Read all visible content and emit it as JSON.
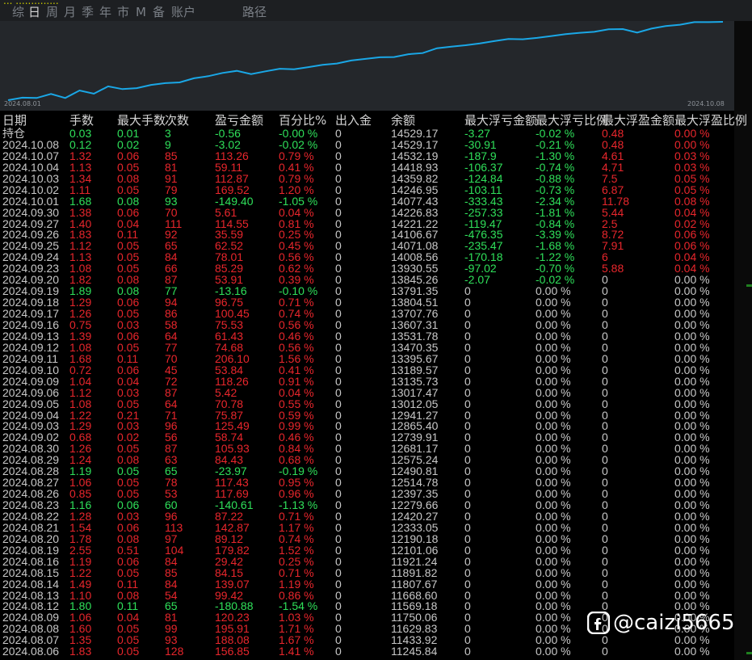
{
  "header": {
    "title_fragment": "... ..............",
    "tabs": [
      {
        "label": "综",
        "active": false
      },
      {
        "label": "日",
        "active": true
      },
      {
        "label": "周",
        "active": false
      },
      {
        "label": "月",
        "active": false
      },
      {
        "label": "季",
        "active": false
      },
      {
        "label": "年",
        "active": false
      },
      {
        "label": "市",
        "active": false
      },
      {
        "label": "M",
        "active": false
      },
      {
        "label": "备",
        "active": false
      },
      {
        "label": "账户",
        "active": false
      },
      {
        "label": "路径",
        "active": false
      }
    ]
  },
  "chart": {
    "start_label": "2024.08.01",
    "end_label": "2024.10.08",
    "line_color": "#1aa7e6",
    "equity_curve": [
      11150,
      11260,
      11245,
      11420,
      11245,
      11570,
      11430,
      11750,
      11630,
      11670,
      11810,
      11890,
      11920,
      12100,
      12190,
      12330,
      12420,
      12280,
      12400,
      12510,
      12490,
      12580,
      12680,
      12740,
      12870,
      12940,
      13010,
      13020,
      13140,
      13190,
      13400,
      13470,
      13530,
      13610,
      13710,
      13800,
      13790,
      13850,
      13930,
      14010,
      14070,
      14110,
      14220,
      14230,
      14080,
      14250,
      14360,
      14420,
      14530,
      14530,
      14545
    ]
  },
  "table": {
    "headers": [
      "日期",
      "手数",
      "最大手数",
      "次数",
      "盈亏金额",
      "百分比%",
      "出入金",
      "余额",
      "最大浮亏金额",
      "最大浮亏比例",
      "最大浮盈金额",
      "最大浮盈比例"
    ],
    "colors": {
      "red": "#e8262c",
      "green": "#2fe05a",
      "neutral": "#c8c8c8"
    },
    "rows": [
      {
        "date": "持仓",
        "lots": "0.03",
        "maxlots": "0.01",
        "count": "3",
        "pnl": "-0.56",
        "pct": "-0.00 %",
        "io": "0",
        "bal": "14529.17",
        "mfl": "-3.27",
        "mflp": "-0.02 %",
        "mfp": "0.48",
        "mfpp": "0.00 %",
        "tone": "green"
      },
      {
        "date": "2024.10.08",
        "lots": "0.12",
        "maxlots": "0.02",
        "count": "9",
        "pnl": "-3.02",
        "pct": "-0.02 %",
        "io": "0",
        "bal": "14529.17",
        "mfl": "-30.91",
        "mflp": "-0.21 %",
        "mfp": "0.48",
        "mfpp": "0.00 %",
        "tone": "green"
      },
      {
        "date": "2024.10.07",
        "lots": "1.32",
        "maxlots": "0.06",
        "count": "85",
        "pnl": "113.26",
        "pct": "0.79 %",
        "io": "0",
        "bal": "14532.19",
        "mfl": "-187.9",
        "mflp": "-1.30 %",
        "mfp": "4.61",
        "mfpp": "0.03 %",
        "tone": "red"
      },
      {
        "date": "2024.10.04",
        "lots": "1.13",
        "maxlots": "0.05",
        "count": "81",
        "pnl": "59.11",
        "pct": "0.41 %",
        "io": "0",
        "bal": "14418.93",
        "mfl": "-106.37",
        "mflp": "-0.74 %",
        "mfp": "4.71",
        "mfpp": "0.03 %",
        "tone": "red"
      },
      {
        "date": "2024.10.03",
        "lots": "1.34",
        "maxlots": "0.08",
        "count": "91",
        "pnl": "112.87",
        "pct": "0.79 %",
        "io": "0",
        "bal": "14359.82",
        "mfl": "-124.84",
        "mflp": "-0.88 %",
        "mfp": "7.5",
        "mfpp": "0.05 %",
        "tone": "red"
      },
      {
        "date": "2024.10.02",
        "lots": "1.11",
        "maxlots": "0.05",
        "count": "79",
        "pnl": "169.52",
        "pct": "1.20 %",
        "io": "0",
        "bal": "14246.95",
        "mfl": "-103.11",
        "mflp": "-0.73 %",
        "mfp": "6.87",
        "mfpp": "0.05 %",
        "tone": "red"
      },
      {
        "date": "2024.10.01",
        "lots": "1.68",
        "maxlots": "0.08",
        "count": "93",
        "pnl": "-149.40",
        "pct": "-1.05 %",
        "io": "0",
        "bal": "14077.43",
        "mfl": "-333.43",
        "mflp": "-2.34 %",
        "mfp": "11.78",
        "mfpp": "0.08 %",
        "tone": "green"
      },
      {
        "date": "2024.09.30",
        "lots": "1.38",
        "maxlots": "0.06",
        "count": "70",
        "pnl": "5.61",
        "pct": "0.04 %",
        "io": "0",
        "bal": "14226.83",
        "mfl": "-257.33",
        "mflp": "-1.81 %",
        "mfp": "5.44",
        "mfpp": "0.04 %",
        "tone": "red"
      },
      {
        "date": "2024.09.27",
        "lots": "1.40",
        "maxlots": "0.04",
        "count": "111",
        "pnl": "114.55",
        "pct": "0.81 %",
        "io": "0",
        "bal": "14221.22",
        "mfl": "-119.47",
        "mflp": "-0.84 %",
        "mfp": "2.5",
        "mfpp": "0.02 %",
        "tone": "red"
      },
      {
        "date": "2024.09.26",
        "lots": "1.83",
        "maxlots": "0.11",
        "count": "92",
        "pnl": "35.59",
        "pct": "0.25 %",
        "io": "0",
        "bal": "14106.67",
        "mfl": "-476.35",
        "mflp": "-3.39 %",
        "mfp": "8.72",
        "mfpp": "0.06 %",
        "tone": "red"
      },
      {
        "date": "2024.09.25",
        "lots": "1.12",
        "maxlots": "0.05",
        "count": "65",
        "pnl": "62.52",
        "pct": "0.45 %",
        "io": "0",
        "bal": "14071.08",
        "mfl": "-235.47",
        "mflp": "-1.68 %",
        "mfp": "7.91",
        "mfpp": "0.06 %",
        "tone": "red"
      },
      {
        "date": "2024.09.24",
        "lots": "1.13",
        "maxlots": "0.05",
        "count": "84",
        "pnl": "78.01",
        "pct": "0.56 %",
        "io": "0",
        "bal": "14008.56",
        "mfl": "-170.18",
        "mflp": "-1.22 %",
        "mfp": "6",
        "mfpp": "0.04 %",
        "tone": "red"
      },
      {
        "date": "2024.09.23",
        "lots": "1.08",
        "maxlots": "0.05",
        "count": "66",
        "pnl": "85.29",
        "pct": "0.62 %",
        "io": "0",
        "bal": "13930.55",
        "mfl": "-97.02",
        "mflp": "-0.70 %",
        "mfp": "5.88",
        "mfpp": "0.04 %",
        "tone": "red"
      },
      {
        "date": "2024.09.20",
        "lots": "1.82",
        "maxlots": "0.08",
        "count": "87",
        "pnl": "53.91",
        "pct": "0.39 %",
        "io": "0",
        "bal": "13845.26",
        "mfl": "-2.07",
        "mflp": "-0.02 %",
        "mfp": "0",
        "mfpp": "0.00 %",
        "tone": "red"
      },
      {
        "date": "2024.09.19",
        "lots": "1.89",
        "maxlots": "0.08",
        "count": "77",
        "pnl": "-13.16",
        "pct": "-0.10 %",
        "io": "0",
        "bal": "13791.35",
        "mfl": "0",
        "mflp": "0.00 %",
        "mfp": "0",
        "mfpp": "0.00 %",
        "tone": "green"
      },
      {
        "date": "2024.09.18",
        "lots": "1.29",
        "maxlots": "0.06",
        "count": "94",
        "pnl": "96.75",
        "pct": "0.71 %",
        "io": "0",
        "bal": "13804.51",
        "mfl": "0",
        "mflp": "0.00 %",
        "mfp": "0",
        "mfpp": "0.00 %",
        "tone": "red"
      },
      {
        "date": "2024.09.17",
        "lots": "1.26",
        "maxlots": "0.05",
        "count": "86",
        "pnl": "100.45",
        "pct": "0.74 %",
        "io": "0",
        "bal": "13707.76",
        "mfl": "0",
        "mflp": "0.00 %",
        "mfp": "0",
        "mfpp": "0.00 %",
        "tone": "red"
      },
      {
        "date": "2024.09.16",
        "lots": "0.75",
        "maxlots": "0.03",
        "count": "58",
        "pnl": "75.53",
        "pct": "0.56 %",
        "io": "0",
        "bal": "13607.31",
        "mfl": "0",
        "mflp": "0.00 %",
        "mfp": "0",
        "mfpp": "0.00 %",
        "tone": "red"
      },
      {
        "date": "2024.09.13",
        "lots": "1.39",
        "maxlots": "0.06",
        "count": "64",
        "pnl": "61.43",
        "pct": "0.46 %",
        "io": "0",
        "bal": "13531.78",
        "mfl": "0",
        "mflp": "0.00 %",
        "mfp": "0",
        "mfpp": "0.00 %",
        "tone": "red"
      },
      {
        "date": "2024.09.12",
        "lots": "1.08",
        "maxlots": "0.05",
        "count": "77",
        "pnl": "74.68",
        "pct": "0.56 %",
        "io": "0",
        "bal": "13470.35",
        "mfl": "0",
        "mflp": "0.00 %",
        "mfp": "0",
        "mfpp": "0.00 %",
        "tone": "red"
      },
      {
        "date": "2024.09.11",
        "lots": "1.68",
        "maxlots": "0.11",
        "count": "70",
        "pnl": "206.10",
        "pct": "1.56 %",
        "io": "0",
        "bal": "13395.67",
        "mfl": "0",
        "mflp": "0.00 %",
        "mfp": "0",
        "mfpp": "0.00 %",
        "tone": "red"
      },
      {
        "date": "2024.09.10",
        "lots": "0.72",
        "maxlots": "0.06",
        "count": "45",
        "pnl": "53.84",
        "pct": "0.41 %",
        "io": "0",
        "bal": "13189.57",
        "mfl": "0",
        "mflp": "0.00 %",
        "mfp": "0",
        "mfpp": "0.00 %",
        "tone": "red"
      },
      {
        "date": "2024.09.09",
        "lots": "1.04",
        "maxlots": "0.04",
        "count": "72",
        "pnl": "118.26",
        "pct": "0.91 %",
        "io": "0",
        "bal": "13135.73",
        "mfl": "0",
        "mflp": "0.00 %",
        "mfp": "0",
        "mfpp": "0.00 %",
        "tone": "red"
      },
      {
        "date": "2024.09.06",
        "lots": "1.12",
        "maxlots": "0.03",
        "count": "87",
        "pnl": "5.42",
        "pct": "0.04 %",
        "io": "0",
        "bal": "13017.47",
        "mfl": "0",
        "mflp": "0.00 %",
        "mfp": "0",
        "mfpp": "0.00 %",
        "tone": "red"
      },
      {
        "date": "2024.09.05",
        "lots": "1.08",
        "maxlots": "0.05",
        "count": "64",
        "pnl": "70.78",
        "pct": "0.55 %",
        "io": "0",
        "bal": "13012.05",
        "mfl": "0",
        "mflp": "0.00 %",
        "mfp": "0",
        "mfpp": "0.00 %",
        "tone": "red"
      },
      {
        "date": "2024.09.04",
        "lots": "1.22",
        "maxlots": "0.21",
        "count": "71",
        "pnl": "75.87",
        "pct": "0.59 %",
        "io": "0",
        "bal": "12941.27",
        "mfl": "0",
        "mflp": "0.00 %",
        "mfp": "0",
        "mfpp": "0.00 %",
        "tone": "red"
      },
      {
        "date": "2024.09.03",
        "lots": "1.29",
        "maxlots": "0.03",
        "count": "96",
        "pnl": "125.49",
        "pct": "0.99 %",
        "io": "0",
        "bal": "12865.40",
        "mfl": "0",
        "mflp": "0.00 %",
        "mfp": "0",
        "mfpp": "0.00 %",
        "tone": "red"
      },
      {
        "date": "2024.09.02",
        "lots": "0.68",
        "maxlots": "0.02",
        "count": "56",
        "pnl": "58.74",
        "pct": "0.46 %",
        "io": "0",
        "bal": "12739.91",
        "mfl": "0",
        "mflp": "0.00 %",
        "mfp": "0",
        "mfpp": "0.00 %",
        "tone": "red"
      },
      {
        "date": "2024.08.30",
        "lots": "1.26",
        "maxlots": "0.05",
        "count": "87",
        "pnl": "105.93",
        "pct": "0.84 %",
        "io": "0",
        "bal": "12681.17",
        "mfl": "0",
        "mflp": "0.00 %",
        "mfp": "0",
        "mfpp": "0.00 %",
        "tone": "red"
      },
      {
        "date": "2024.08.29",
        "lots": "1.24",
        "maxlots": "0.08",
        "count": "63",
        "pnl": "84.43",
        "pct": "0.68 %",
        "io": "0",
        "bal": "12575.24",
        "mfl": "0",
        "mflp": "0.00 %",
        "mfp": "0",
        "mfpp": "0.00 %",
        "tone": "red"
      },
      {
        "date": "2024.08.28",
        "lots": "1.19",
        "maxlots": "0.05",
        "count": "65",
        "pnl": "-23.97",
        "pct": "-0.19 %",
        "io": "0",
        "bal": "12490.81",
        "mfl": "0",
        "mflp": "0.00 %",
        "mfp": "0",
        "mfpp": "0.00 %",
        "tone": "green"
      },
      {
        "date": "2024.08.27",
        "lots": "1.06",
        "maxlots": "0.05",
        "count": "78",
        "pnl": "117.43",
        "pct": "0.95 %",
        "io": "0",
        "bal": "12514.78",
        "mfl": "0",
        "mflp": "0.00 %",
        "mfp": "0",
        "mfpp": "0.00 %",
        "tone": "red"
      },
      {
        "date": "2024.08.26",
        "lots": "0.85",
        "maxlots": "0.05",
        "count": "53",
        "pnl": "117.69",
        "pct": "0.96 %",
        "io": "0",
        "bal": "12397.35",
        "mfl": "0",
        "mflp": "0.00 %",
        "mfp": "0",
        "mfpp": "0.00 %",
        "tone": "red"
      },
      {
        "date": "2024.08.23",
        "lots": "1.16",
        "maxlots": "0.06",
        "count": "60",
        "pnl": "-140.61",
        "pct": "-1.13 %",
        "io": "0",
        "bal": "12279.66",
        "mfl": "0",
        "mflp": "0.00 %",
        "mfp": "0",
        "mfpp": "0.00 %",
        "tone": "green"
      },
      {
        "date": "2024.08.22",
        "lots": "1.28",
        "maxlots": "0.03",
        "count": "96",
        "pnl": "87.22",
        "pct": "0.71 %",
        "io": "0",
        "bal": "12420.27",
        "mfl": "0",
        "mflp": "0.00 %",
        "mfp": "0",
        "mfpp": "0.00 %",
        "tone": "red"
      },
      {
        "date": "2024.08.21",
        "lots": "1.54",
        "maxlots": "0.06",
        "count": "113",
        "pnl": "142.87",
        "pct": "1.17 %",
        "io": "0",
        "bal": "12333.05",
        "mfl": "0",
        "mflp": "0.00 %",
        "mfp": "0",
        "mfpp": "0.00 %",
        "tone": "red"
      },
      {
        "date": "2024.08.20",
        "lots": "1.78",
        "maxlots": "0.08",
        "count": "97",
        "pnl": "89.12",
        "pct": "0.74 %",
        "io": "0",
        "bal": "12190.18",
        "mfl": "0",
        "mflp": "0.00 %",
        "mfp": "0",
        "mfpp": "0.00 %",
        "tone": "red"
      },
      {
        "date": "2024.08.19",
        "lots": "2.55",
        "maxlots": "0.51",
        "count": "104",
        "pnl": "179.82",
        "pct": "1.52 %",
        "io": "0",
        "bal": "12101.06",
        "mfl": "0",
        "mflp": "0.00 %",
        "mfp": "0",
        "mfpp": "0.00 %",
        "tone": "red"
      },
      {
        "date": "2024.08.16",
        "lots": "1.19",
        "maxlots": "0.06",
        "count": "84",
        "pnl": "29.42",
        "pct": "0.25 %",
        "io": "0",
        "bal": "11921.24",
        "mfl": "0",
        "mflp": "0.00 %",
        "mfp": "0",
        "mfpp": "0.00 %",
        "tone": "red"
      },
      {
        "date": "2024.08.15",
        "lots": "1.22",
        "maxlots": "0.05",
        "count": "85",
        "pnl": "84.15",
        "pct": "0.71 %",
        "io": "0",
        "bal": "11891.82",
        "mfl": "0",
        "mflp": "0.00 %",
        "mfp": "0",
        "mfpp": "0.00 %",
        "tone": "red"
      },
      {
        "date": "2024.08.14",
        "lots": "1.49",
        "maxlots": "0.11",
        "count": "84",
        "pnl": "139.07",
        "pct": "1.19 %",
        "io": "0",
        "bal": "11807.67",
        "mfl": "0",
        "mflp": "0.00 %",
        "mfp": "0",
        "mfpp": "0.00 %",
        "tone": "red"
      },
      {
        "date": "2024.08.13",
        "lots": "1.10",
        "maxlots": "0.08",
        "count": "54",
        "pnl": "99.42",
        "pct": "0.86 %",
        "io": "0",
        "bal": "11668.60",
        "mfl": "0",
        "mflp": "0.00 %",
        "mfp": "0",
        "mfpp": "0.00 %",
        "tone": "red"
      },
      {
        "date": "2024.08.12",
        "lots": "1.80",
        "maxlots": "0.11",
        "count": "65",
        "pnl": "-180.88",
        "pct": "-1.54 %",
        "io": "0",
        "bal": "11569.18",
        "mfl": "0",
        "mflp": "0.00 %",
        "mfp": "0",
        "mfpp": "0.00 %",
        "tone": "green"
      },
      {
        "date": "2024.08.09",
        "lots": "1.06",
        "maxlots": "0.04",
        "count": "81",
        "pnl": "120.23",
        "pct": "1.03 %",
        "io": "0",
        "bal": "11750.06",
        "mfl": "0",
        "mflp": "0.00 %",
        "mfp": "0",
        "mfpp": "0.00 %",
        "tone": "red"
      },
      {
        "date": "2024.08.08",
        "lots": "1.60",
        "maxlots": "0.05",
        "count": "99",
        "pnl": "195.91",
        "pct": "1.71 %",
        "io": "0",
        "bal": "11629.83",
        "mfl": "0",
        "mflp": "0.00 %",
        "mfp": "0",
        "mfpp": "0.00 %",
        "tone": "red"
      },
      {
        "date": "2024.08.07",
        "lots": "1.35",
        "maxlots": "0.05",
        "count": "93",
        "pnl": "188.08",
        "pct": "1.67 %",
        "io": "0",
        "bal": "11433.92",
        "mfl": "0",
        "mflp": "0.00 %",
        "mfp": "0",
        "mfpp": "0.00 %",
        "tone": "red"
      },
      {
        "date": "2024.08.06",
        "lots": "1.83",
        "maxlots": "0.05",
        "count": "128",
        "pnl": "156.85",
        "pct": "1.41 %",
        "io": "0",
        "bal": "11245.84",
        "mfl": "0",
        "mflp": "0.00 %",
        "mfp": "0",
        "mfpp": "0.00 %",
        "tone": "red"
      }
    ]
  },
  "watermark": {
    "text": "@caizi5665",
    "icon": "chat-logo-icon"
  }
}
